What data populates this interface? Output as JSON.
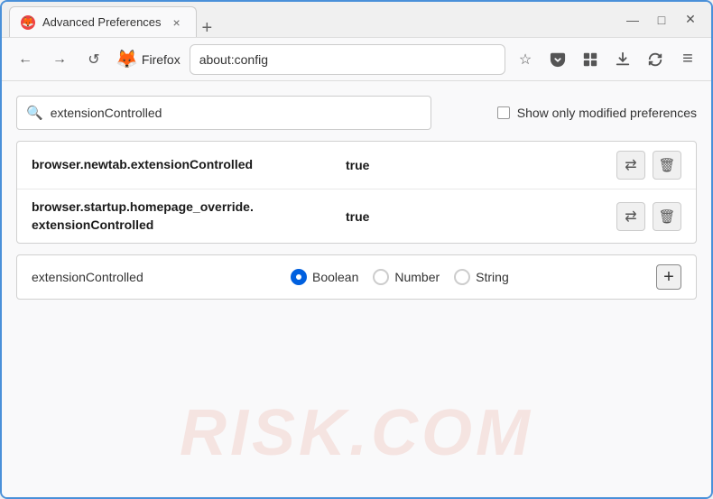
{
  "window": {
    "title": "Advanced Preferences",
    "tab_close_label": "×",
    "new_tab_label": "+",
    "controls": {
      "minimize": "—",
      "maximize": "□",
      "close": "✕"
    }
  },
  "nav": {
    "back_label": "←",
    "forward_label": "→",
    "refresh_label": "↺",
    "browser_name": "Firefox",
    "address": "about:config",
    "bookmark_icon": "☆",
    "pocket_icon": "⊽",
    "extensions_icon": "⧄",
    "downloads_icon": "⊡",
    "sync_icon": "⟳",
    "menu_icon": "≡"
  },
  "search": {
    "placeholder": "extensionControlled",
    "value": "extensionControlled",
    "show_modified_label": "Show only modified preferences"
  },
  "results": {
    "rows": [
      {
        "name": "browser.newtab.extensionControlled",
        "value": "true"
      },
      {
        "name": "browser.startup.homepage_override.\nextensionControlled",
        "name_line1": "browser.startup.homepage_override.",
        "name_line2": "extensionControlled",
        "value": "true",
        "multiline": true
      }
    ]
  },
  "new_pref": {
    "name": "extensionControlled",
    "types": [
      {
        "label": "Boolean",
        "selected": true
      },
      {
        "label": "Number",
        "selected": false
      },
      {
        "label": "String",
        "selected": false
      }
    ],
    "add_label": "+"
  },
  "watermark": {
    "text": "RISK.COM"
  }
}
